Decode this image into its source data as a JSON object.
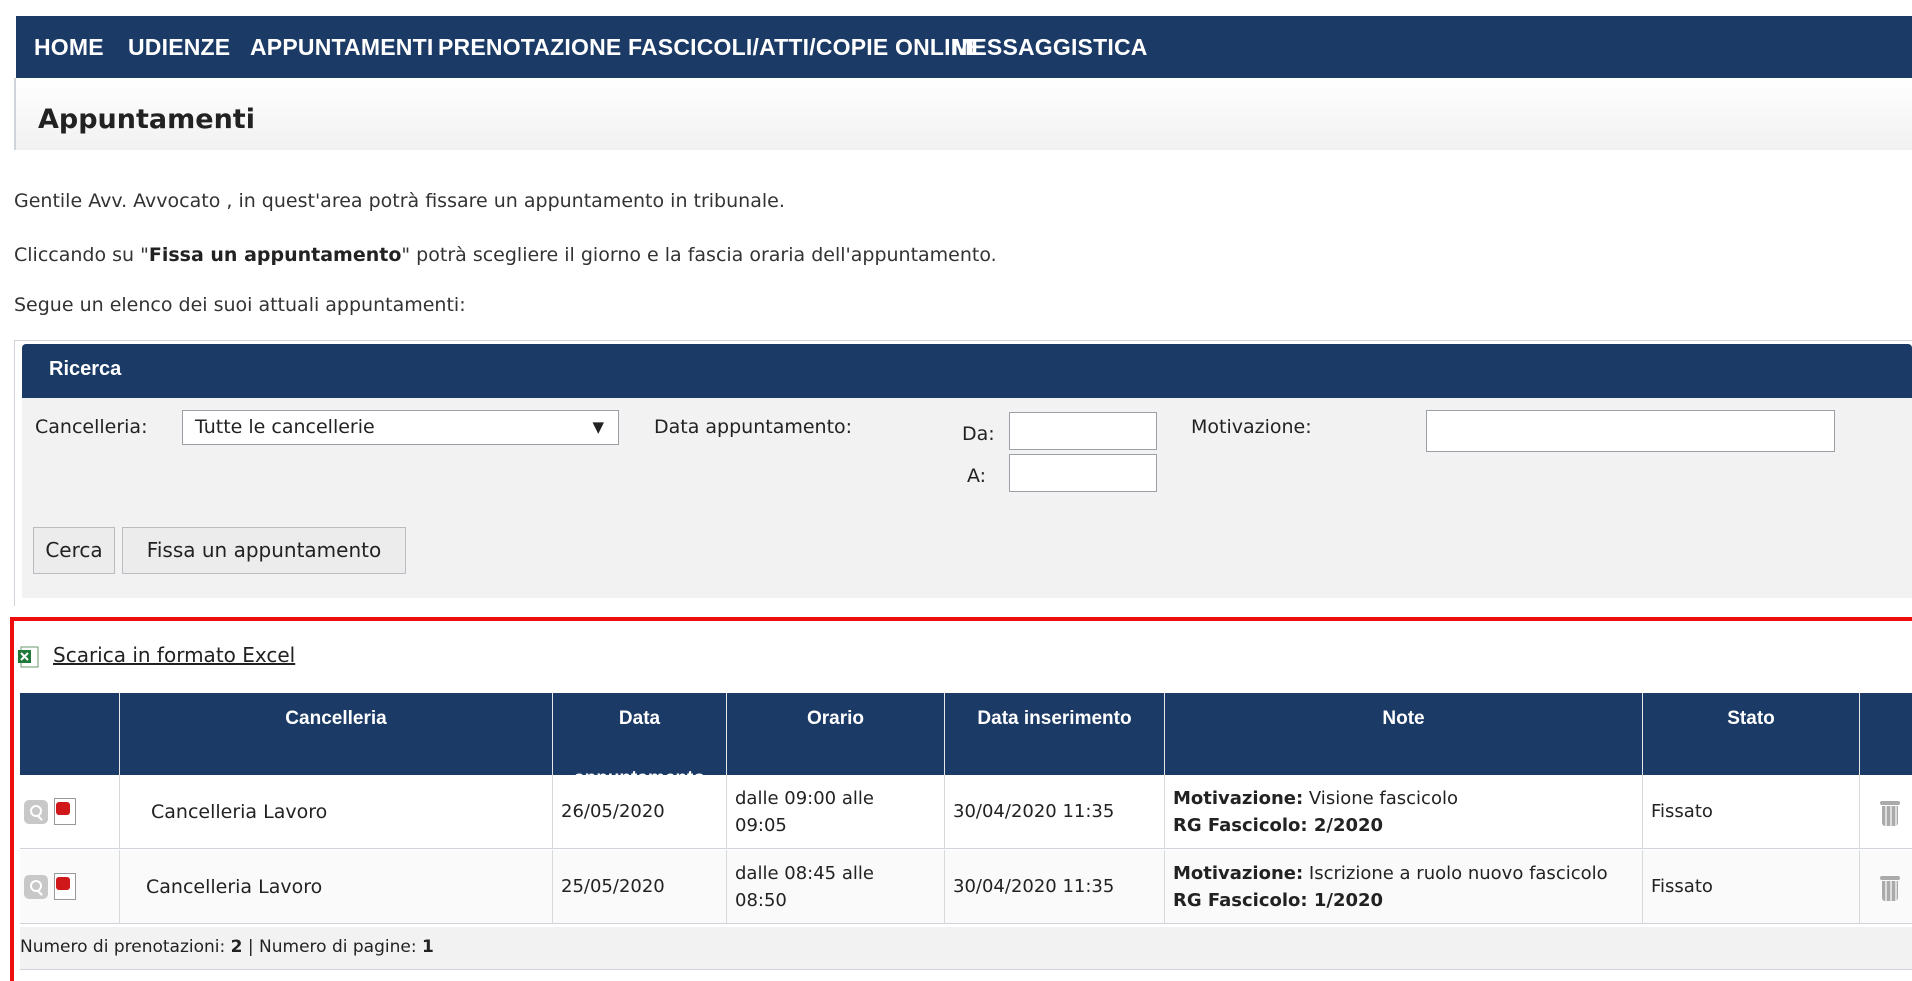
{
  "nav": {
    "items": [
      "HOME",
      "UDIENZE",
      "APPUNTAMENTI",
      "PRENOTAZIONE FASCICOLI/ATTI/COPIE ONLINE",
      "MESSAGGISTICA"
    ]
  },
  "page": {
    "title": "Appuntamenti",
    "intro_1": "Gentile Avv. Avvocato            , in quest'area potrà fissare un appuntamento in tribunale.",
    "intro_2_prefix": "Cliccando su \"",
    "intro_2_bold": "Fissa un appuntamento",
    "intro_2_suffix": "\" potrà scegliere il giorno e la fascia oraria dell'appuntamento.",
    "intro_3": "Segue un elenco dei suoi attuali appuntamenti:"
  },
  "search": {
    "header": "Ricerca",
    "cancelleria_label": "Cancelleria:",
    "cancelleria_value": "Tutte le cancellerie",
    "date_label": "Data appuntamento:",
    "from_label": "Da:",
    "to_label": "A:",
    "from_value": "",
    "to_value": "",
    "motivazione_label": "Motivazione:",
    "motivazione_value": "",
    "search_button": "Cerca",
    "new_button": "Fissa un appuntamento"
  },
  "results": {
    "excel_link": "Scarica in formato Excel",
    "columns": {
      "cancelleria": "Cancelleria",
      "data_line1": "Data",
      "data_line2": "appuntamento",
      "orario": "Orario",
      "data_inserimento": "Data inserimento",
      "note": "Note",
      "stato": "Stato"
    },
    "rows": [
      {
        "cancelleria": "Cancelleria Lavoro",
        "data": "26/05/2020",
        "orario_1": "dalle 09:00 alle",
        "orario_2": "09:05",
        "inserimento": "30/04/2020 11:35",
        "motivazione_label": "Motivazione:",
        "motivazione": " Visione fascicolo",
        "rg": "RG Fascicolo: 2/2020",
        "stato": "Fissato"
      },
      {
        "cancelleria": "Cancelleria Lavoro",
        "data": "25/05/2020",
        "orario_1": "dalle 08:45 alle",
        "orario_2": "08:50",
        "inserimento": "30/04/2020 11:35",
        "motivazione_label": "Motivazione:",
        "motivazione": " Iscrizione a ruolo nuovo fascicolo",
        "rg": "RG Fascicolo: 1/2020",
        "stato": "Fissato"
      }
    ],
    "footer_label_1": "Numero di prenotazioni: ",
    "footer_count": "2",
    "footer_sep": " | Numero di pagine: ",
    "footer_pages": "1"
  },
  "colors": {
    "nav_bg": "#1b3a66",
    "highlight_border": "#ee0d0d"
  }
}
